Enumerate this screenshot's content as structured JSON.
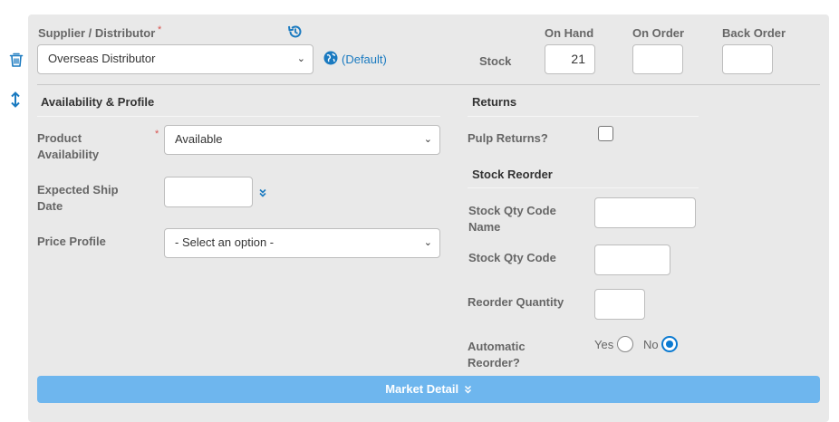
{
  "supplier": {
    "label": "Supplier / Distributor",
    "required_mark": "*",
    "value": "Overseas Distributor",
    "default_link": "(Default)"
  },
  "stock": {
    "label": "Stock",
    "columns": [
      "On Hand",
      "On Order",
      "Back Order"
    ],
    "values": [
      "21",
      "",
      ""
    ]
  },
  "availability": {
    "section_title": "Availability & Profile",
    "product_availability_label": "Product Availability",
    "product_availability_value": "Available",
    "required_mark": "*",
    "expected_ship_date_label": "Expected Ship Date",
    "expected_ship_date_value": "",
    "price_profile_label": "Price Profile",
    "price_profile_value": "- Select an option -"
  },
  "returns": {
    "section_title": "Returns",
    "pulp_returns_label": "Pulp Returns?",
    "pulp_returns_checked": false
  },
  "stock_reorder": {
    "section_title": "Stock Reorder",
    "qty_code_name_label": "Stock Qty Code Name",
    "qty_code_name_value": "",
    "qty_code_label": "Stock Qty Code",
    "qty_code_value": "",
    "reorder_qty_label": "Reorder Quantity",
    "reorder_qty_value": "",
    "auto_reorder_label": "Automatic Reorder?",
    "yes_label": "Yes",
    "no_label": "No",
    "auto_reorder_value": "No"
  },
  "market_detail_button": "Market Detail",
  "icons": {
    "delete": "trash-icon",
    "resize": "vertical-arrows-icon",
    "reset": "history-icon",
    "globe": "globe-icon",
    "expand": "double-chevron-down-icon"
  },
  "colors": {
    "accent": "#1a7ac0",
    "button": "#6eb6ee",
    "required": "#d9534f",
    "panel": "#e9e9e9"
  }
}
